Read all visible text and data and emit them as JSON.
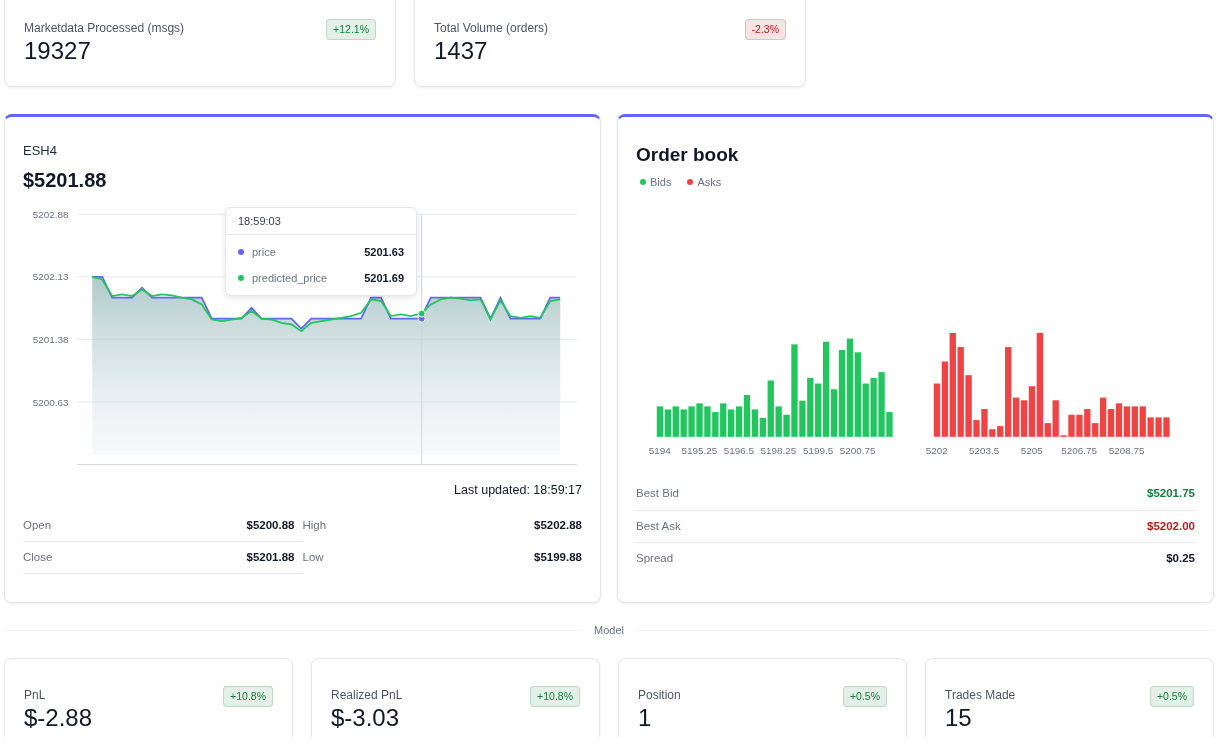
{
  "top_stats": [
    {
      "label": "Marketdata Processed (msgs)",
      "value": "19327",
      "change": "+12.1%",
      "color": "#15803d"
    },
    {
      "label": "Total Volume (orders)",
      "value": "1437",
      "change": "-2.3%",
      "color": "#b91c1c"
    }
  ],
  "price_card": {
    "symbol": "ESH4",
    "price": "$5201.88",
    "chart_data": {
      "type": "line",
      "grid": true,
      "ylim": [
        5199.88,
        5202.88
      ],
      "yticks": [
        5200.63,
        5201.38,
        5202.13,
        5202.88
      ],
      "series": [
        {
          "name": "price",
          "type": "area",
          "color": "#6366f1",
          "values": [
            5202.13,
            5202.13,
            5201.88,
            5201.88,
            5201.88,
            5202.0,
            5201.88,
            5201.88,
            5201.88,
            5201.88,
            5201.88,
            5201.88,
            5201.63,
            5201.63,
            5201.63,
            5201.63,
            5201.76,
            5201.63,
            5201.63,
            5201.63,
            5201.63,
            5201.51,
            5201.63,
            5201.63,
            5201.63,
            5201.63,
            5201.63,
            5201.63,
            5201.88,
            5201.88,
            5201.63,
            5201.63,
            5201.63,
            5201.63,
            5201.88,
            5201.88,
            5201.88,
            5201.88,
            5201.88,
            5201.88,
            5201.63,
            5201.88,
            5201.63,
            5201.63,
            5201.63,
            5201.63,
            5201.88,
            5201.88
          ]
        },
        {
          "name": "predicted_price",
          "type": "line",
          "color": "#22c55e",
          "values": [
            5202.13,
            5202.1,
            5201.9,
            5201.92,
            5201.9,
            5201.98,
            5201.9,
            5201.92,
            5201.91,
            5201.88,
            5201.86,
            5201.8,
            5201.62,
            5201.6,
            5201.62,
            5201.64,
            5201.72,
            5201.63,
            5201.62,
            5201.58,
            5201.56,
            5201.48,
            5201.58,
            5201.6,
            5201.62,
            5201.64,
            5201.66,
            5201.7,
            5201.86,
            5201.84,
            5201.66,
            5201.68,
            5201.66,
            5201.69,
            5201.8,
            5201.86,
            5201.88,
            5201.87,
            5201.85,
            5201.86,
            5201.62,
            5201.85,
            5201.66,
            5201.64,
            5201.66,
            5201.64,
            5201.84,
            5201.86
          ]
        }
      ]
    },
    "tooltip": {
      "title": "18:59:03",
      "values": [
        "5201.63",
        "5201.69"
      ]
    },
    "last_updated": "Last updated: 18:59:17",
    "stats": [
      {
        "label": "Open",
        "value": "$5200.88"
      },
      {
        "label": "High",
        "value": "$5202.88"
      },
      {
        "label": "Close",
        "value": "$5201.88"
      },
      {
        "label": "Low",
        "value": "$5199.88"
      }
    ]
  },
  "order_book": {
    "title": "Order book",
    "legend": [
      {
        "name": "Bids",
        "color": "#22c55e"
      },
      {
        "name": "Asks",
        "color": "#ef4444"
      }
    ],
    "bid_axis_labels": [
      "5194",
      "5195.25",
      "5196.5",
      "5198.25",
      "5199.5",
      "5200.75"
    ],
    "ask_axis_labels": [
      "5202",
      "5203.5",
      "5205",
      "5206.75",
      "5208.75"
    ],
    "rows": [
      {
        "label": "Best Bid",
        "value": "$5201.75",
        "color": "#15803d"
      },
      {
        "label": "Best Ask",
        "value": "$5202.00",
        "color": "#b91c1c"
      },
      {
        "label": "Spread",
        "value": "$0.25",
        "color": "#111827"
      }
    ]
  },
  "section_label": "Model",
  "model_stats": [
    {
      "label": "PnL",
      "value": "$-2.88",
      "change": "+10.8%",
      "color": "#15803d"
    },
    {
      "label": "Realized PnL",
      "value": "$-3.03",
      "change": "+10.8%",
      "color": "#15803d"
    },
    {
      "label": "Position",
      "value": "1",
      "change": "+0.5%",
      "color": "#15803d"
    },
    {
      "label": "Trades Made",
      "value": "15",
      "change": "+0.5%",
      "color": "#15803d"
    }
  ]
}
